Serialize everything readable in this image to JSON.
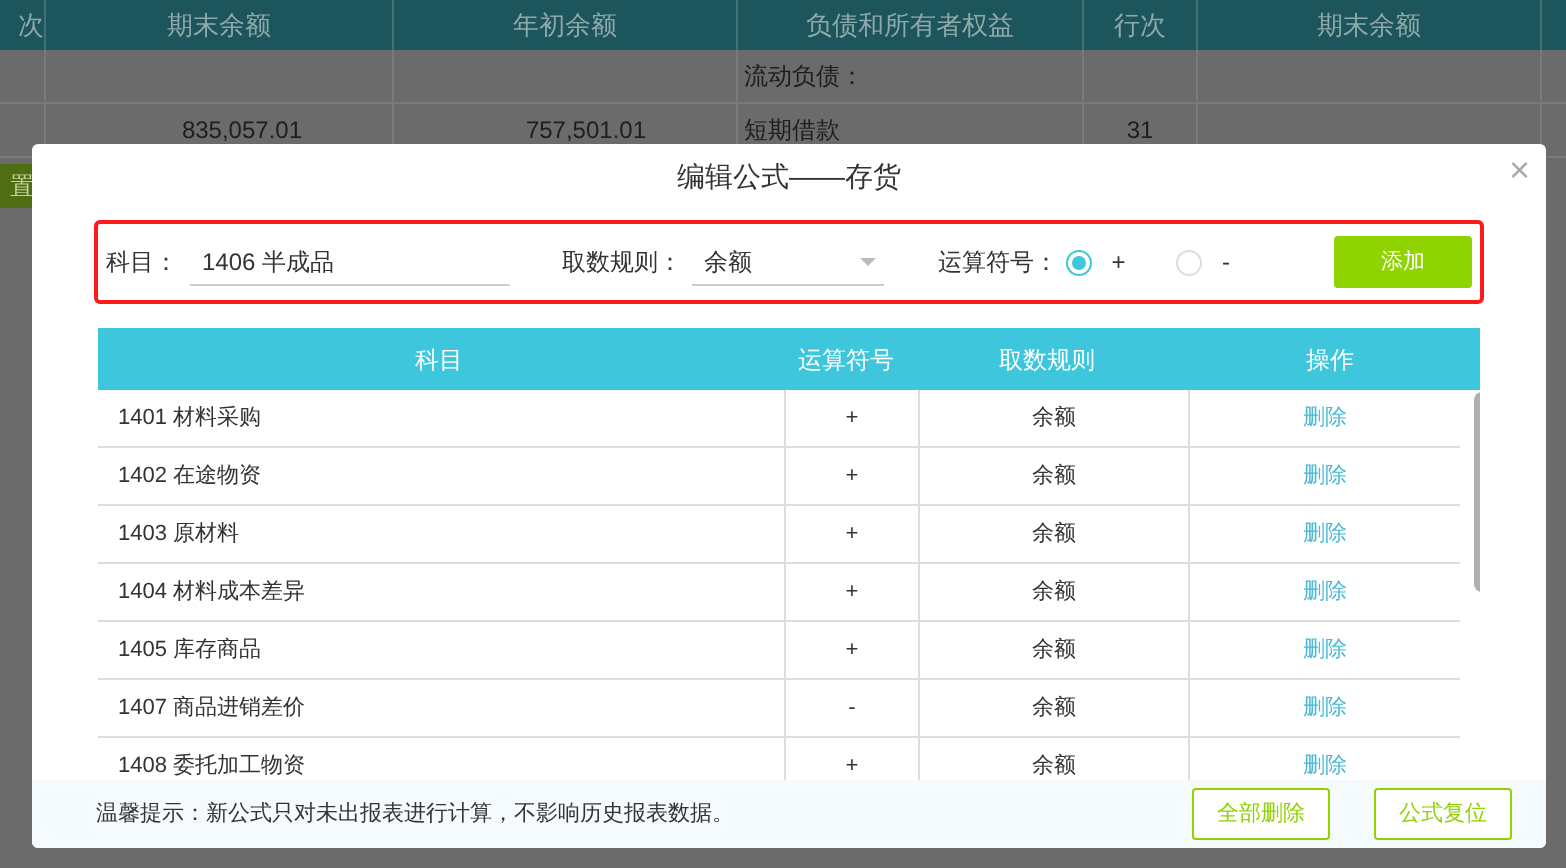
{
  "background_table": {
    "columns": [
      "次",
      "期末余额",
      "年初余额",
      "负债和所有者权益",
      "行次",
      "期末余额"
    ],
    "rows": [
      {
        "cells": [
          "",
          "",
          "",
          "流动负债：",
          "",
          ""
        ]
      },
      {
        "cells": [
          "",
          "835,057.01",
          "757,501.01",
          "短期借款",
          "31",
          ""
        ]
      }
    ]
  },
  "side_button": "置",
  "dialog": {
    "title": "编辑公式——存货",
    "close": "×",
    "form": {
      "subject_label": "科目：",
      "subject_value": "1406 半成品",
      "rule_label": "取数规则：",
      "rule_value": "余额",
      "operator_label": "运算符号：",
      "operators": [
        {
          "label": "+",
          "selected": true
        },
        {
          "label": "-",
          "selected": false
        }
      ],
      "add_button": "添加"
    },
    "table": {
      "columns": [
        "科目",
        "运算符号",
        "取数规则",
        "操作"
      ],
      "rows": [
        {
          "subject": "1401 材料采购",
          "operator": "+",
          "rule": "余额",
          "action": "删除"
        },
        {
          "subject": "1402 在途物资",
          "operator": "+",
          "rule": "余额",
          "action": "删除"
        },
        {
          "subject": "1403 原材料",
          "operator": "+",
          "rule": "余额",
          "action": "删除"
        },
        {
          "subject": "1404 材料成本差异",
          "operator": "+",
          "rule": "余额",
          "action": "删除"
        },
        {
          "subject": "1405 库存商品",
          "operator": "+",
          "rule": "余额",
          "action": "删除"
        },
        {
          "subject": "1407 商品进销差价",
          "operator": "-",
          "rule": "余额",
          "action": "删除"
        },
        {
          "subject": "1408 委托加工物资",
          "operator": "+",
          "rule": "余额",
          "action": "删除"
        }
      ]
    },
    "footer": {
      "tip": "温馨提示：新公式只对未出报表进行计算，不影响历史报表数据。",
      "buttons": [
        "全部删除",
        "公式复位"
      ]
    }
  }
}
